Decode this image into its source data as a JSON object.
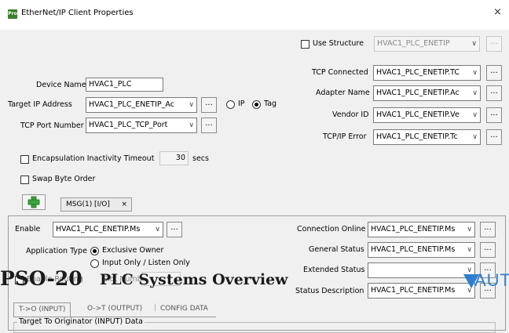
{
  "window": {
    "title": "EtherNet/IP Client Properties",
    "icon_text": "Pro",
    "close_glyph": "×"
  },
  "use_structure": {
    "label": "Use Structure",
    "value": "HVAC1_PLC_ENETIP",
    "button": "..."
  },
  "left": {
    "device_name": {
      "label": "Device Name",
      "value": "HVAC1_PLC"
    },
    "target_ip": {
      "label": "Target IP Address",
      "value": "HVAC1_PLC_ENETIP_Ac",
      "button": "...",
      "ip_label": "IP",
      "tag_label": "Tag"
    },
    "tcp_port": {
      "label": "TCP Port Number",
      "value": "HVAC1_PLC_TCP_Port",
      "button": "..."
    },
    "encap": {
      "label": "Encapsulation Inactivity Timeout",
      "value": "30",
      "unit": "secs"
    },
    "swap": {
      "label": "Swap Byte Order"
    }
  },
  "right": {
    "tcp_connected": {
      "label": "TCP Connected",
      "value": "HVAC1_PLC_ENETIP.TC",
      "button": "..."
    },
    "adapter_name": {
      "label": "Adapter Name",
      "value": "HVAC1_PLC_ENETIP.Ac",
      "button": "..."
    },
    "vendor_id": {
      "label": "Vendor ID",
      "value": "HVAC1_PLC_ENETIP.Ve",
      "button": "..."
    },
    "tcpip_error": {
      "label": "TCP/IP Error",
      "value": "HVAC1_PLC_ENETIP.Tc",
      "button": "..."
    }
  },
  "msg": {
    "add_icon": "plus-icon",
    "tab_label": "MSG(1) [I/O]",
    "tab_close": "×",
    "enable": {
      "label": "Enable",
      "value": "HVAC1_PLC_ENETIP.Ms",
      "button": "..."
    },
    "app_type": {
      "label": "Application Type",
      "opt1": "Exclusive Owner",
      "opt2": "Input Only / Listen Only"
    },
    "routing": {
      "label": "Enable Routing",
      "slot_label": "Slot Number"
    },
    "conn_online": {
      "label": "Connection Online",
      "value": "HVAC1_PLC_ENETIP.Ms",
      "button": "..."
    },
    "general_status": {
      "label": "General Status",
      "value": "HVAC1_PLC_ENETIP.Ms",
      "button": "..."
    },
    "extended_status": {
      "label": "Extended Status",
      "value": "",
      "button": "..."
    },
    "status_desc": {
      "label": "Status Description",
      "value": "HVAC1_PLC_ENETIP.Ms",
      "button": "..."
    },
    "subtabs": [
      "T->O (INPUT)",
      "O->T (OUTPUT)",
      "CONFIG DATA"
    ],
    "group_title": "Target To Originator (INPUT) Data"
  },
  "overlay": {
    "code": "PSO-20",
    "title": "PLC Systems Overview",
    "brand": "AUTO",
    "brand_color": "#2f7fd0"
  }
}
